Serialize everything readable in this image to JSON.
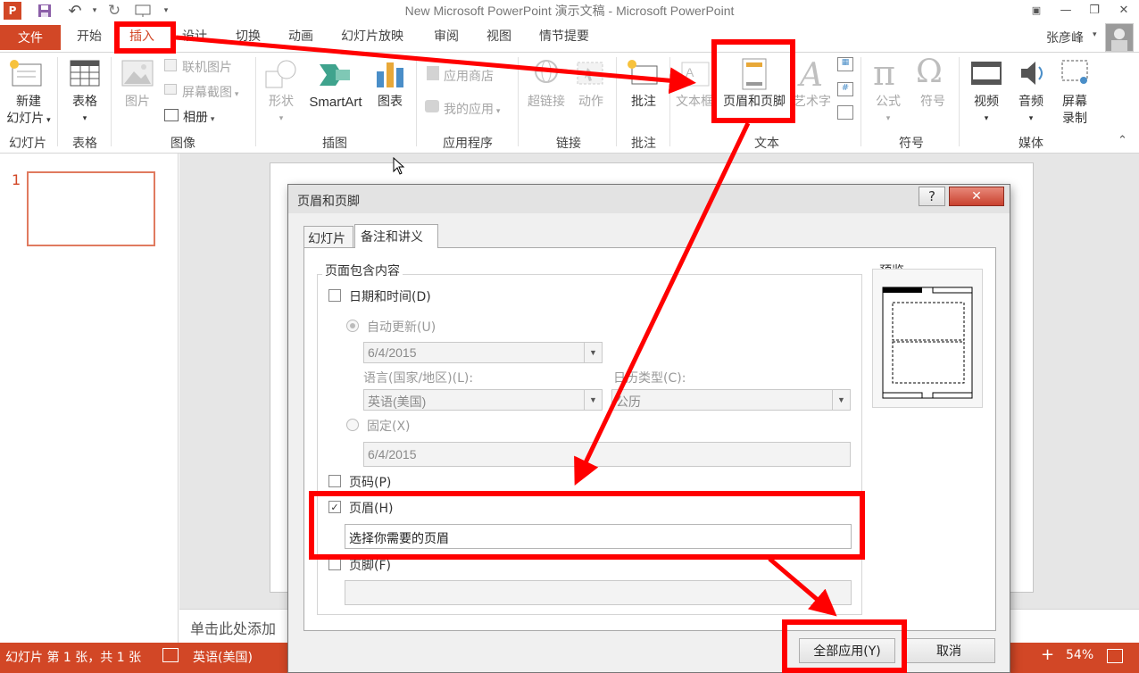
{
  "window": {
    "title": "New Microsoft PowerPoint 演示文稿 - Microsoft PowerPoint",
    "minimize": "—",
    "restore": "❐",
    "close": "✕"
  },
  "tabs": {
    "file": "文件",
    "items": [
      "开始",
      "插入",
      "设计",
      "切换",
      "动画",
      "幻灯片放映",
      "审阅",
      "视图",
      "情节提要"
    ],
    "user": "张彦峰"
  },
  "ribbon": {
    "new_slide": "新建",
    "new_slide2": "幻灯片",
    "table": "表格",
    "picture": "图片",
    "online_picture": "联机图片",
    "screenshot": "屏幕截图",
    "album": "相册",
    "shapes": "形状",
    "smartart": "SmartArt",
    "chart": "图表",
    "app_store": "应用商店",
    "my_apps": "我的应用",
    "hyperlink": "超链接",
    "action": "动作",
    "comment": "批注",
    "textbox": "文本框",
    "header_footer": "页眉和页脚",
    "wordart": "艺术字",
    "equation": "公式",
    "symbol": "符号",
    "video": "视频",
    "audio": "音频",
    "screen_record": "屏幕",
    "screen_record2": "录制",
    "groups": {
      "slides": "幻灯片",
      "tables": "表格",
      "images": "图像",
      "illustrations": "插图",
      "apps": "应用程序",
      "links": "链接",
      "comments": "批注",
      "text": "文本",
      "symbols": "符号",
      "media": "媒体"
    }
  },
  "slides_pane": {
    "number": "1"
  },
  "notes_placeholder": "单击此处添加",
  "status": {
    "slide_info": "幻灯片 第 1 张，共 1 张",
    "language": "英语(美国)",
    "zoom": "54%"
  },
  "dialog": {
    "title": "页眉和页脚",
    "help": "?",
    "close": "✕",
    "tab_slide": "幻灯片",
    "tab_notes": "备注和讲义",
    "section_title": "页面包含内容",
    "date_time": "日期和时间(D)",
    "auto_update": "自动更新(U)",
    "auto_date": "6/4/2015",
    "language_label": "语言(国家/地区)(L):",
    "language_value": "英语(美国)",
    "calendar_label": "日历类型(C):",
    "calendar_value": "公历",
    "fixed": "固定(X)",
    "fixed_value": "6/4/2015",
    "page_number": "页码(P)",
    "header": "页眉(H)",
    "header_checked": true,
    "header_value": "选择你需要的页眉",
    "footer": "页脚(F)",
    "footer_value": "",
    "preview": "预览",
    "apply_all": "全部应用(Y)",
    "cancel": "取消"
  },
  "colors": {
    "accent": "#d24726",
    "annotation": "#ff0000"
  }
}
